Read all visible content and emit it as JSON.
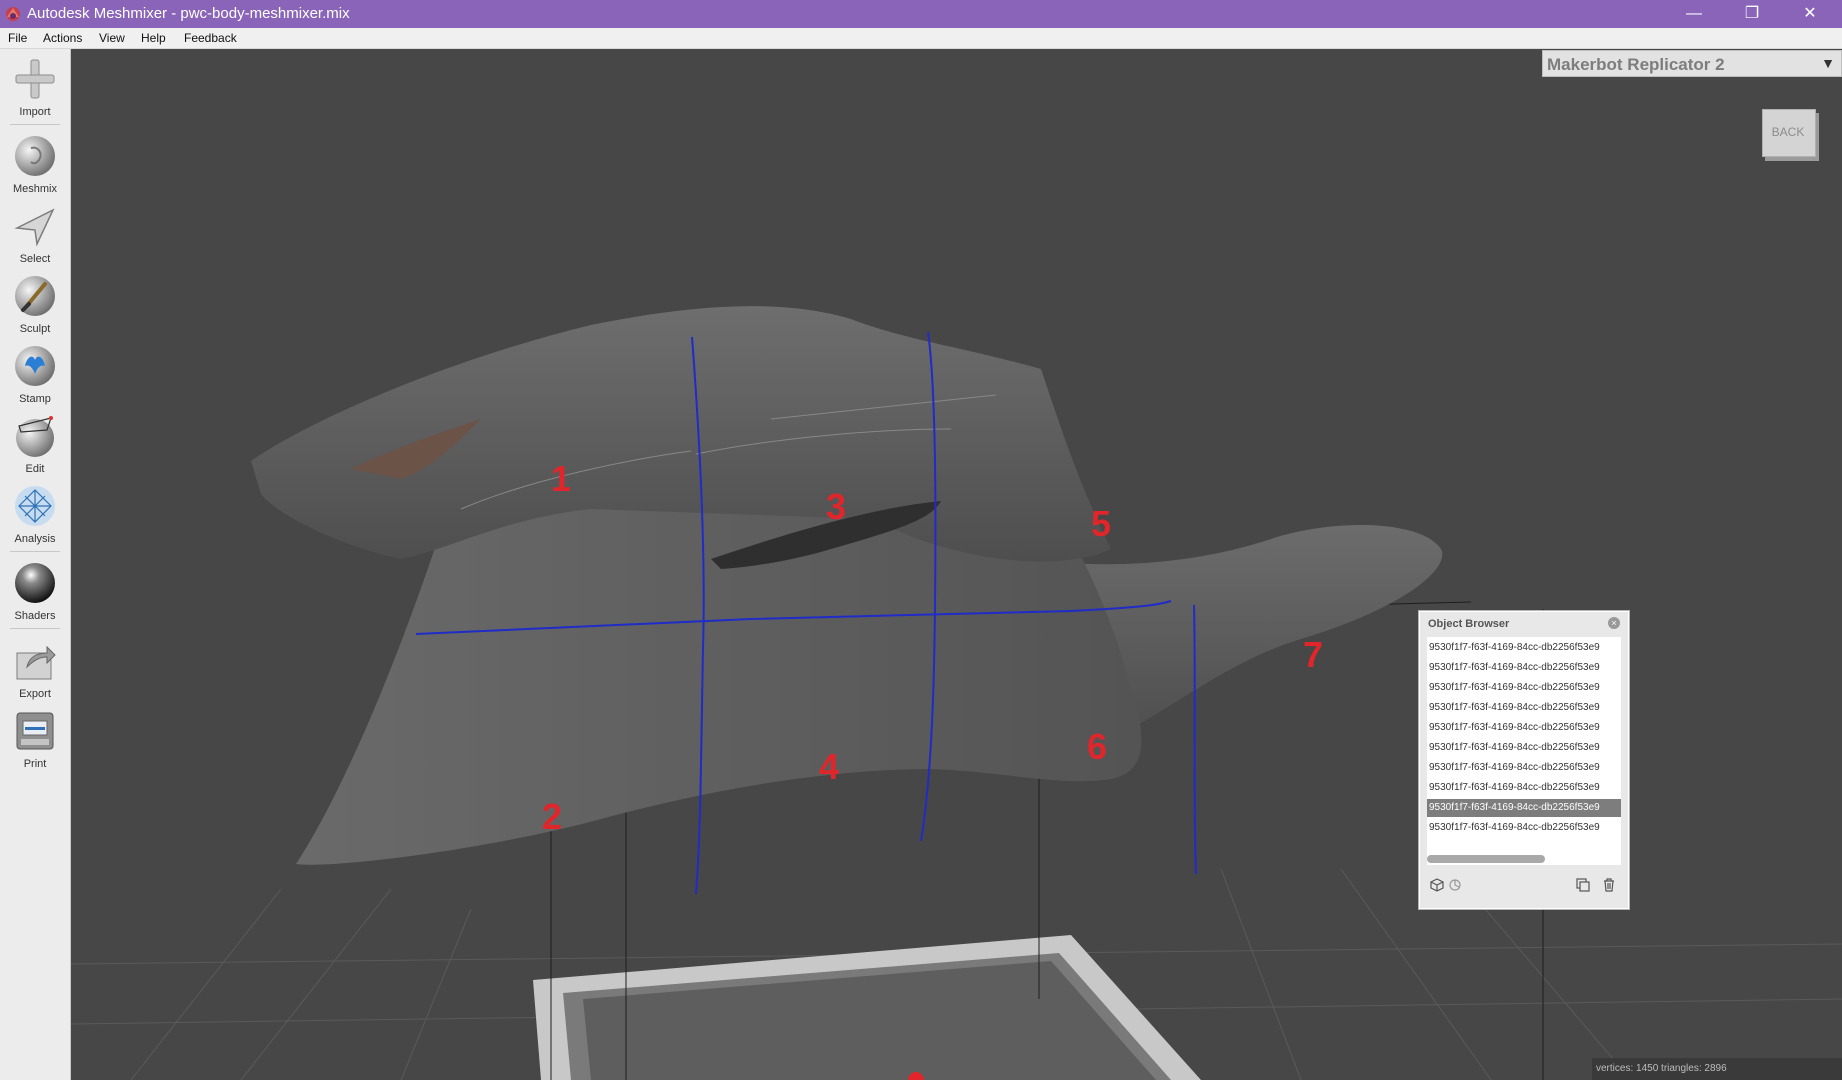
{
  "window": {
    "title": "Autodesk Meshmixer - pwc-body-meshmixer.mix",
    "minimize_glyph": "—",
    "maximize_glyph": "❐",
    "close_glyph": "✕",
    "accent_color": "#8a64b8"
  },
  "menubar": {
    "items": [
      "File",
      "Actions",
      "View",
      "Help",
      "Feedback"
    ]
  },
  "toolbar": {
    "tools": [
      {
        "label": "Import",
        "icon": "plus-icon"
      },
      {
        "label": "Meshmix",
        "icon": "meshmix-icon"
      },
      {
        "label": "Select",
        "icon": "select-arrow-icon"
      },
      {
        "label": "Sculpt",
        "icon": "sculpt-brush-icon"
      },
      {
        "label": "Stamp",
        "icon": "stamp-icon"
      },
      {
        "label": "Edit",
        "icon": "edit-sphere-icon"
      },
      {
        "label": "Analysis",
        "icon": "analysis-icon"
      },
      {
        "label": "Shaders",
        "icon": "shaders-sphere-icon"
      },
      {
        "label": "Export",
        "icon": "export-icon"
      },
      {
        "label": "Print",
        "icon": "print-icon"
      }
    ]
  },
  "printer": {
    "selected": "Makerbot Replicator 2",
    "arrow_glyph": "▼"
  },
  "viewcube": {
    "label": "BACK"
  },
  "model": {
    "region_labels": [
      "1",
      "2",
      "3",
      "4",
      "5",
      "6",
      "7"
    ],
    "label_color": "#e0262b",
    "seam_color": "#1f2cc8"
  },
  "object_browser": {
    "title": "Object Browser",
    "close_glyph": "×",
    "items": [
      "9530f1f7-f63f-4169-84cc-db2256f53e9",
      "9530f1f7-f63f-4169-84cc-db2256f53e9",
      "9530f1f7-f63f-4169-84cc-db2256f53e9",
      "9530f1f7-f63f-4169-84cc-db2256f53e9",
      "9530f1f7-f63f-4169-84cc-db2256f53e9",
      "9530f1f7-f63f-4169-84cc-db2256f53e9",
      "9530f1f7-f63f-4169-84cc-db2256f53e9",
      "9530f1f7-f63f-4169-84cc-db2256f53e9",
      "9530f1f7-f63f-4169-84cc-db2256f53e9",
      "9530f1f7-f63f-4169-84cc-db2256f53e9"
    ],
    "selected_index": 8
  },
  "status": {
    "text": "vertices: 1450 triangles: 2896"
  }
}
